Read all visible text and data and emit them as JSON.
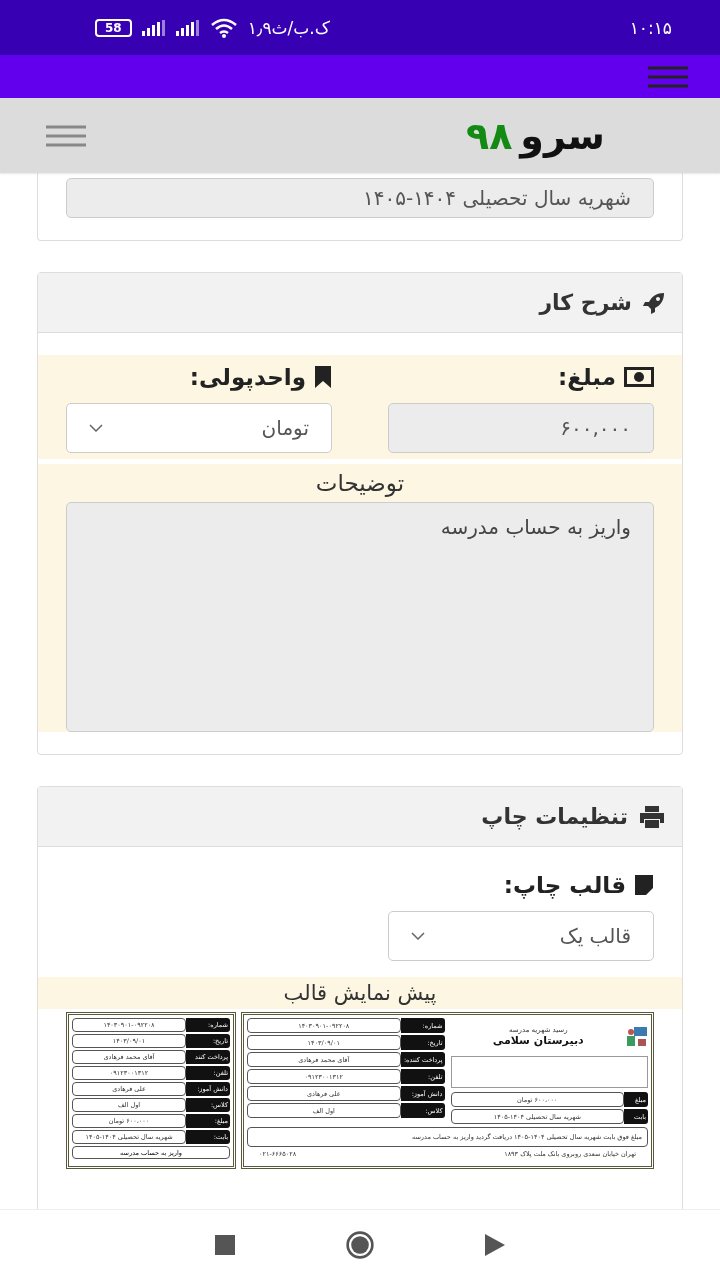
{
  "status_bar": {
    "time": "۱۰:۱۵",
    "network_speed": "۱٫۹ک.ب/ث",
    "battery": "58"
  },
  "header": {
    "logo_text": "سرو",
    "logo_number": "۹۸"
  },
  "top_card": {
    "field_value": "شهریه سال تحصیلی ۱۴۰۴-۱۴۰۵"
  },
  "description_card": {
    "title": "شرح کار",
    "amount_label": "مبلغ:",
    "amount_value": "۶۰۰,۰۰۰",
    "currency_label": "واحدپولی:",
    "currency_value": "تومان",
    "notes_label": "توضیحات",
    "notes_value": "واریز به حساب مدرسه"
  },
  "print_card": {
    "title": "تنظیمات چاپ",
    "template_label": "قالب چاپ:",
    "template_value": "قالب یک",
    "preview_label": "پیش نمایش قالب",
    "receipt": {
      "title": "رسید شهریه مدرسه",
      "school": "دبیرستان سلامی",
      "rows": [
        {
          "label": "شماره:",
          "value": "۱۴۰۳۰۹۰۱-۰۹۲۲۰۸"
        },
        {
          "label": "تاریخ:",
          "value": "۱۴۰۳/۰۹/۰۱"
        },
        {
          "label": "پرداخت کننده:",
          "value": "آقای محمد فرهادی"
        },
        {
          "label": "تلفن:",
          "value": "۰۹۱۲۳۰۰۱۳۱۲"
        },
        {
          "label": "دانش آموز:",
          "value": "علی فرهادی"
        },
        {
          "label": "کلاس:",
          "value": "اول الف"
        }
      ],
      "summary_rows": [
        {
          "label": "مبلغ",
          "value": "۶۰۰،۰۰۰ تومان"
        },
        {
          "label": "بابت",
          "value": "شهریه سال تحصیلی ۱۴۰۴-۱۴۰۵"
        }
      ],
      "sentence": "مبلغ فوق بابت شهریه سال تحصیلی ۱۴۰۴-۱۴۰۵ دریافت گردید واریز به حساب مدرسه",
      "address": "تهران خیابان سعدی روبروی بانک ملت پلاک ۱۸۹۳",
      "phone": "۰۲۱-۶۶۶۵۰۲۸",
      "stub_rows": [
        {
          "label": "شماره:",
          "value": "۱۴۰۳۰۹۰۱-۰۹۲۲۰۸"
        },
        {
          "label": "تاریخ:",
          "value": "۱۴۰۳/۰۹/۰۱"
        },
        {
          "label": "پرداخت کنند",
          "value": "آقای محمد فرهادی"
        },
        {
          "label": "تلفن:",
          "value": "۰۹۱۲۳۰۰۱۳۱۲"
        },
        {
          "label": "دانش آموز:",
          "value": "علی فرهادی"
        },
        {
          "label": "کلاس:",
          "value": "اول الف"
        },
        {
          "label": "مبلغ:",
          "value": "۶۰۰،۰۰۰ تومان"
        },
        {
          "label": "بابت:",
          "value": "شهریه سال تحصیلی ۱۴۰۴-۱۴۰۵"
        }
      ],
      "stub_note": "واریز به حساب مدرسه"
    }
  }
}
